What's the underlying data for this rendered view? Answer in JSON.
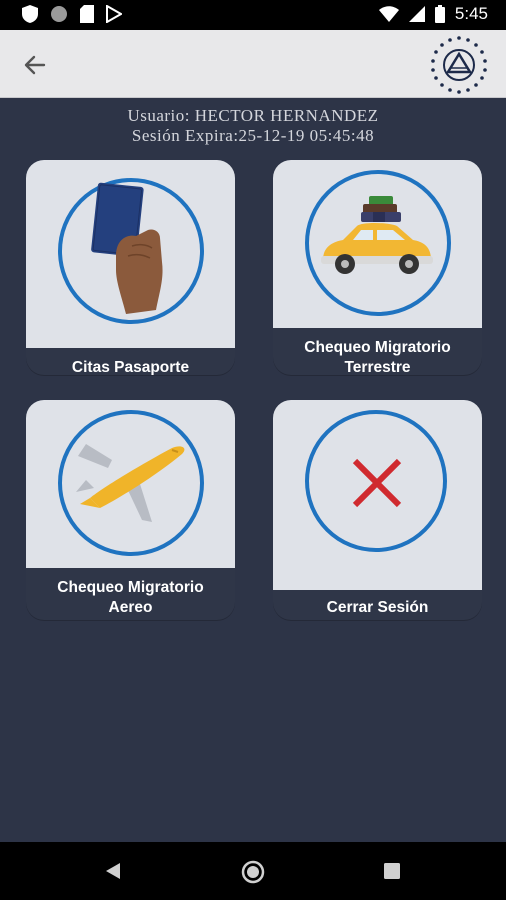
{
  "status_bar": {
    "time": "5:45"
  },
  "user_info": {
    "usuario": "Usuario: HECTOR HERNANDEZ",
    "sesion": "Sesión Expira:25-12-19 05:45:48"
  },
  "tiles": [
    {
      "label": "Citas Pasaporte",
      "icon": "passport-hand-icon"
    },
    {
      "label_line1": "Chequeo Migratorio",
      "label_line2": "Terrestre",
      "icon": "car-luggage-icon"
    },
    {
      "label_line1": "Chequeo Migratorio",
      "label_line2": "Aereo",
      "icon": "airplane-icon"
    },
    {
      "label": "Cerrar Sesión",
      "icon": "close-x-icon"
    }
  ],
  "colors": {
    "background": "#2d3447",
    "ring": "#1f73c0",
    "tile_top": "#dfe2e8",
    "close_x": "#d02a2f"
  }
}
